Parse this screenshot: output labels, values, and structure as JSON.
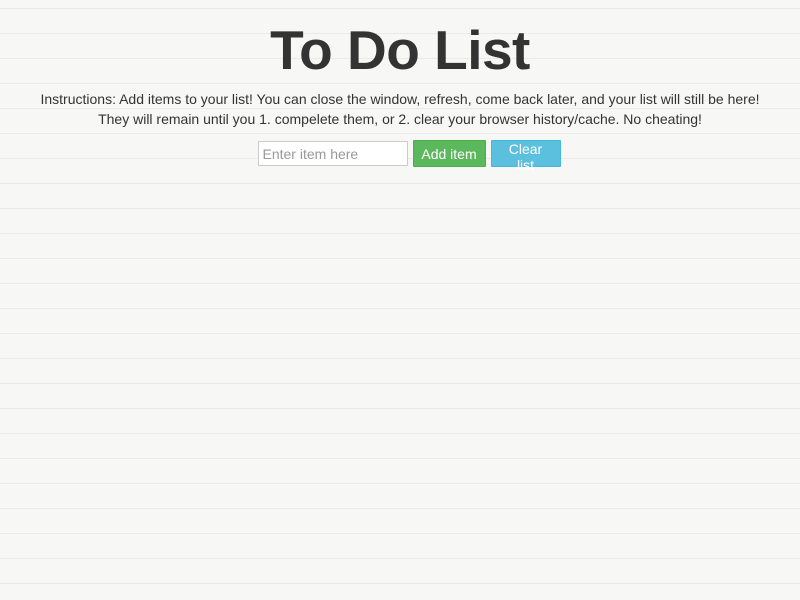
{
  "header": {
    "title": "To Do List"
  },
  "instructions": {
    "line1": "Instructions: Add items to your list! You can close the window, refresh, come back later, and your list will still be here!",
    "line2": "They will remain until you 1. compelete them, or 2. clear your browser history/cache. No cheating!"
  },
  "form": {
    "input_placeholder": "Enter item here",
    "input_value": "",
    "add_label": "Add item",
    "clear_label": "Clear list"
  },
  "list": {
    "items": []
  },
  "colors": {
    "background": "#f7f8f6",
    "text": "#333333",
    "add_button": "#5cb85c",
    "clear_button": "#5bc0de"
  }
}
